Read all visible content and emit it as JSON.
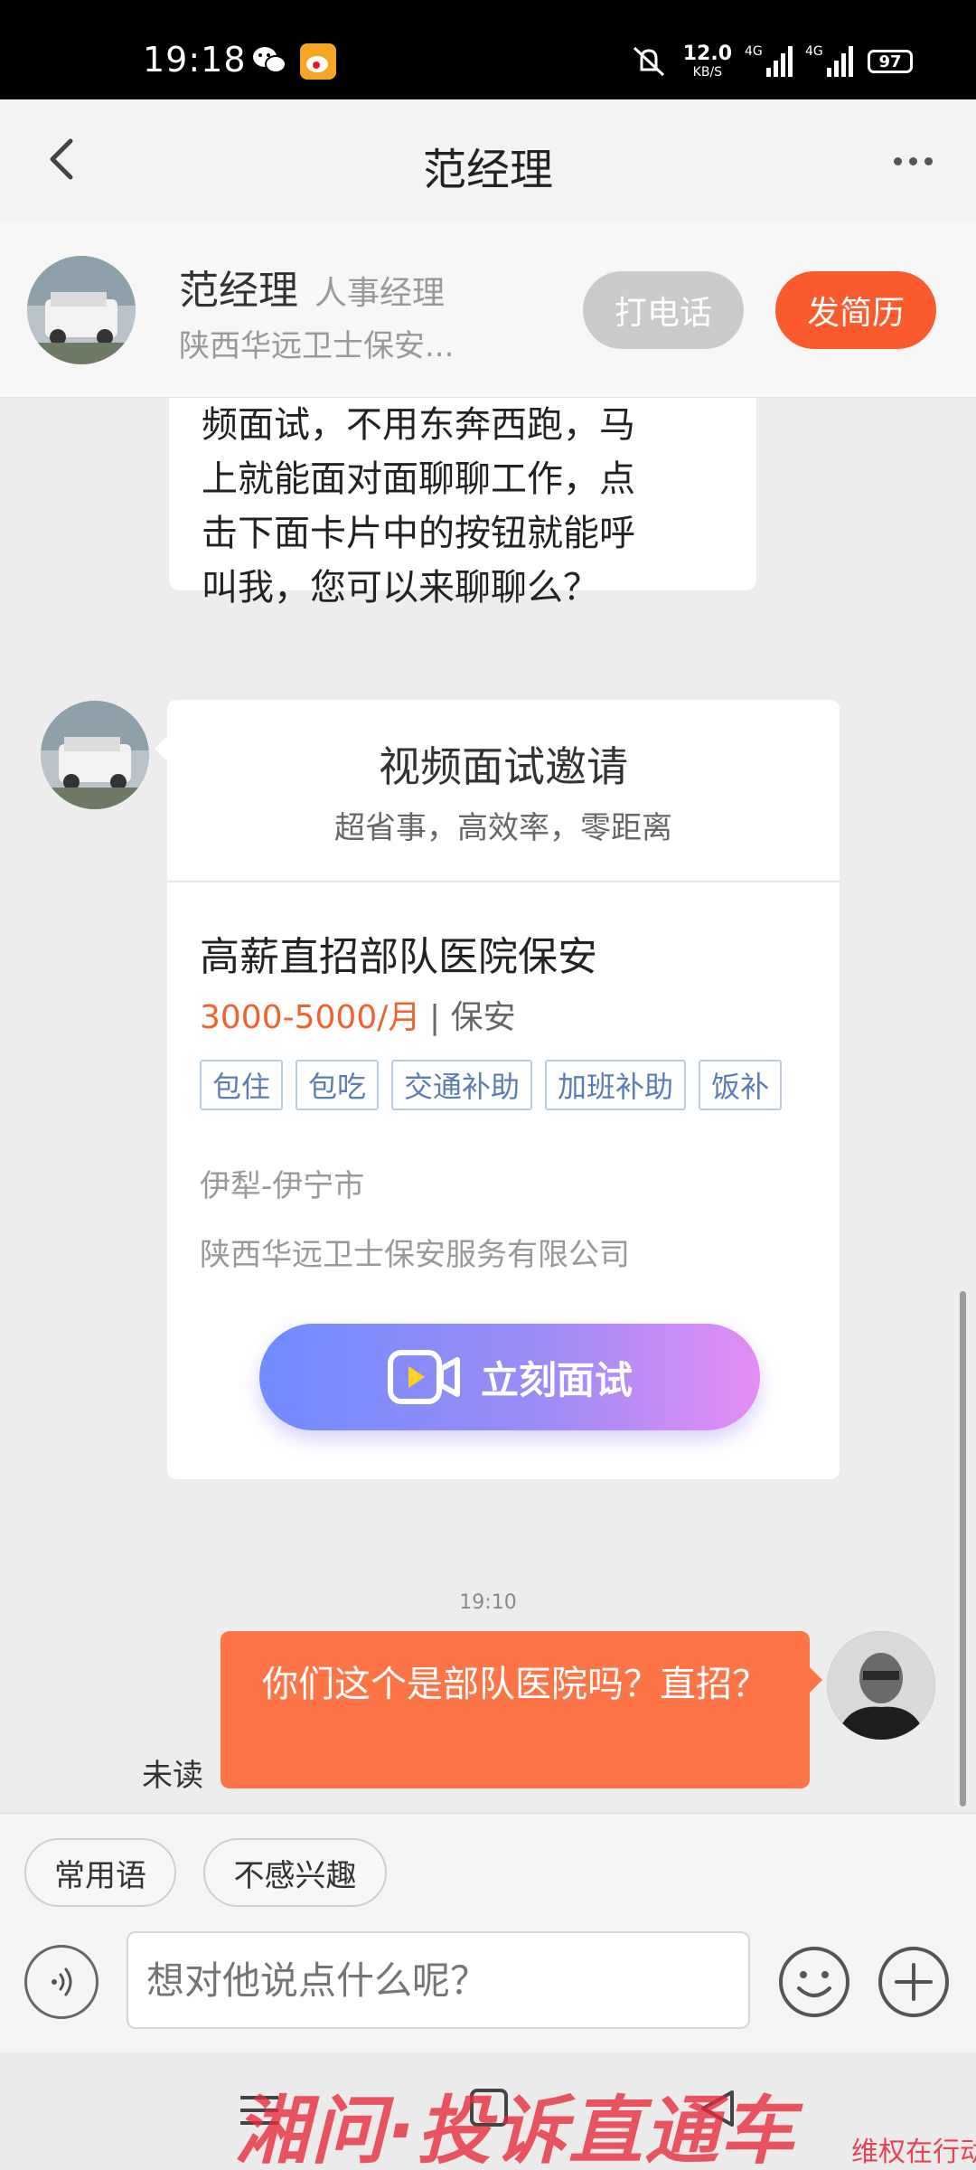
{
  "status_bar": {
    "time": "19:18",
    "net_speed": "12.0",
    "net_unit": "KB/S",
    "signal1": "4G",
    "signal2": "4G",
    "battery": "97"
  },
  "header": {
    "title": "范经理"
  },
  "contact": {
    "name": "范经理",
    "role": "人事经理",
    "company": "陕西华远卫士保安...",
    "call_label": "打电话",
    "resume_label": "发简历"
  },
  "chat": {
    "incoming_lines": [
      "频面试，不用东奔西跑，马",
      "上就能面对面聊聊工作，点",
      "击下面卡片中的按钮就能呼",
      "叫我，您可以来聊聊么？"
    ],
    "card": {
      "title": "视频面试邀请",
      "subtitle": "超省事，高效率，零距离",
      "job_title": "高薪直招部队医院保安",
      "salary": "3000-5000/月",
      "category": "| 保安",
      "tags": [
        "包住",
        "包吃",
        "交通补助",
        "加班补助",
        "饭补"
      ],
      "location": "伊犁-伊宁市",
      "company": "陕西华远卫士保安服务有限公司",
      "button_label": "立刻面试"
    },
    "timestamp": "19:10",
    "outgoing_text": "你们这个是部队医院吗？直招？",
    "unread_label": "未读"
  },
  "input": {
    "quick_replies": [
      "常用语",
      "不感兴趣"
    ],
    "placeholder": "想对他说点什么呢？"
  },
  "watermark": {
    "main": "湘问·投诉直通车",
    "sub": "维权在行动"
  },
  "colors": {
    "accent": "#fb5a2c",
    "outgoing_bubble": "#fd7447",
    "salary": "#f06230",
    "tag_text": "#5b7cb6"
  }
}
